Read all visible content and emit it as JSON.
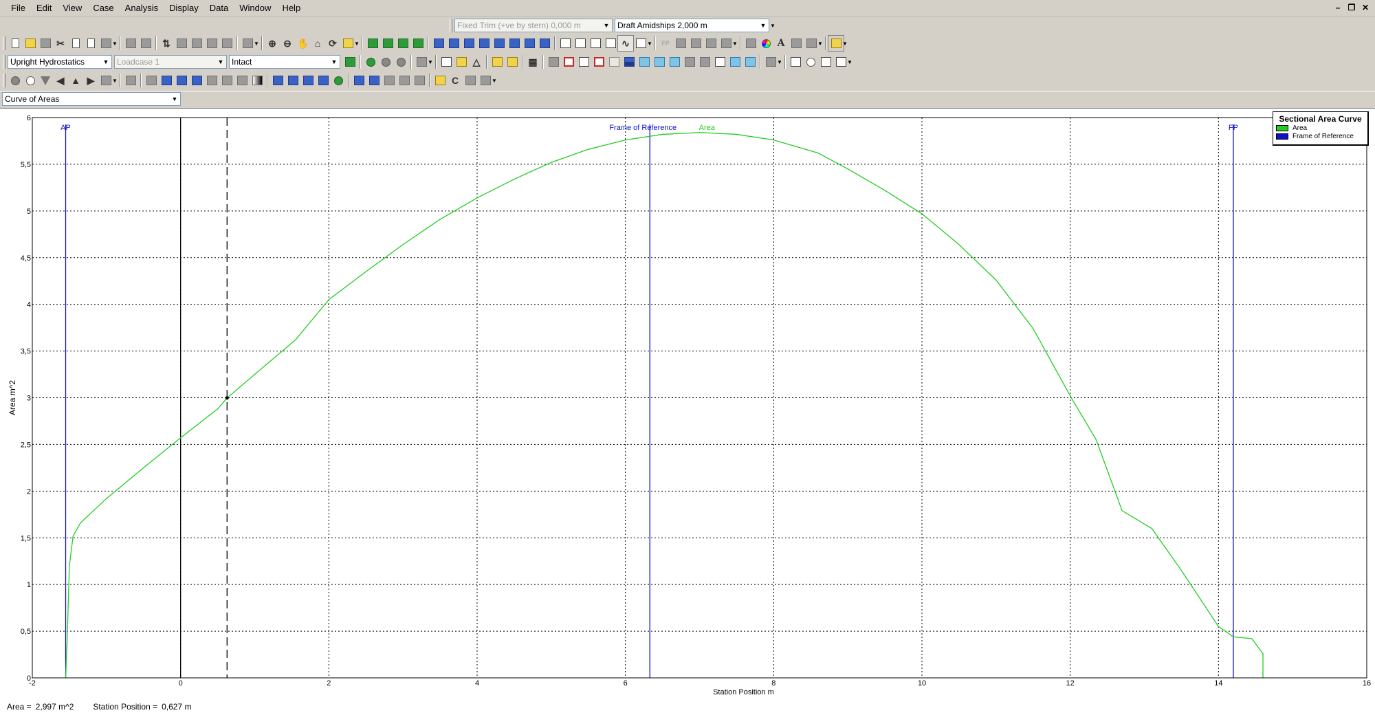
{
  "menu": [
    "File",
    "Edit",
    "View",
    "Case",
    "Analysis",
    "Display",
    "Data",
    "Window",
    "Help"
  ],
  "toolbar_top": {
    "trim": "Fixed Trim (+ve by stern) 0,000 m",
    "draft": "Draft Amidships 2,000 m"
  },
  "toolbar_analysis": {
    "analysis_type": "Upright Hydrostatics",
    "loadcase": "Loadcase 1",
    "damage_case": "Intact"
  },
  "view_selector": "Curve of Areas",
  "legend": {
    "title": "Sectional Area Curve",
    "items": [
      {
        "label": "Area",
        "color": "#22cc22"
      },
      {
        "label": "Frame of Reference",
        "color": "#1010cc"
      }
    ]
  },
  "status": {
    "area_label": "Area =",
    "area_value": "2,997 m^2",
    "station_label": "Station Position =",
    "station_value": "0,627 m"
  },
  "chart_data": {
    "type": "line",
    "title": "",
    "xlabel": "Station Position  m",
    "ylabel": "Area  m^2",
    "xlim": [
      -2,
      16
    ],
    "ylim": [
      0,
      6
    ],
    "x_ticks": [
      "-2",
      "0",
      "2",
      "4",
      "6",
      "8",
      "10",
      "12",
      "14",
      "16"
    ],
    "y_ticks": [
      "0",
      "0,5",
      "1",
      "1,5",
      "2",
      "2,5",
      "3",
      "3,5",
      "4",
      "4,5",
      "5",
      "5,5",
      "6"
    ],
    "grid": true,
    "series": [
      {
        "name": "Area",
        "color": "#22cc22",
        "x": [
          -1.55,
          -1.53,
          -1.5,
          -1.45,
          -1.35,
          -1.0,
          -0.5,
          0.0,
          0.5,
          0.627,
          1.0,
          1.55,
          2.0,
          2.5,
          3.0,
          3.5,
          4.0,
          4.5,
          5.0,
          5.5,
          6.0,
          6.5,
          7.0,
          7.5,
          8.0,
          8.6,
          9.0,
          9.5,
          10.0,
          10.5,
          11.0,
          11.5,
          12.0,
          12.35,
          12.7,
          13.1,
          13.5,
          14.0,
          14.2,
          14.45,
          14.6,
          14.6
        ],
        "y": [
          0.0,
          0.4,
          1.2,
          1.52,
          1.66,
          1.92,
          2.25,
          2.57,
          2.88,
          2.997,
          3.25,
          3.62,
          4.05,
          4.35,
          4.64,
          4.91,
          5.14,
          5.34,
          5.52,
          5.66,
          5.76,
          5.82,
          5.84,
          5.82,
          5.76,
          5.62,
          5.45,
          5.22,
          4.97,
          4.64,
          4.26,
          3.74,
          3.02,
          2.55,
          1.79,
          1.6,
          1.15,
          0.55,
          0.44,
          0.42,
          0.26,
          0.0
        ]
      }
    ],
    "markers": [
      {
        "label": "AP",
        "x": -1.55,
        "color": "#1010cc"
      },
      {
        "label": "FP",
        "x": 14.2,
        "color": "#1010cc"
      },
      {
        "label": "Frame of Reference",
        "x": 6.33,
        "color": "#1010cc"
      }
    ],
    "reference_lines": [
      {
        "x": 0.0,
        "style": "solid",
        "color": "#000000"
      },
      {
        "x": 0.627,
        "style": "dashed",
        "color": "#000000"
      }
    ],
    "cursor_point": {
      "x": 0.627,
      "y": 2.997
    },
    "curve_label": {
      "text": "Area",
      "x": 7.1
    }
  }
}
